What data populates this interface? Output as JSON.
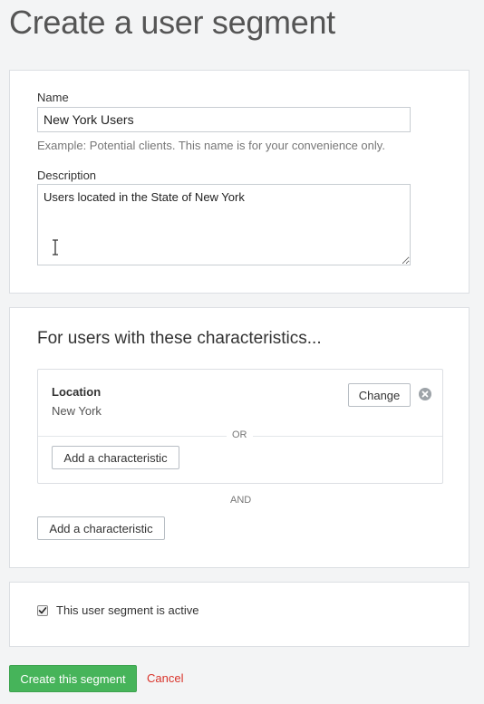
{
  "page": {
    "title": "Create a user segment"
  },
  "form": {
    "name_label": "Name",
    "name_value": "New York Users",
    "name_hint": "Example: Potential clients. This name is for your convenience only.",
    "description_label": "Description",
    "description_value": "Users located in the State of New York"
  },
  "characteristics": {
    "heading": "For users with these characteristics...",
    "items": [
      {
        "name": "Location",
        "value": "New York",
        "change_label": "Change",
        "remove_icon": "close-circle-icon"
      }
    ],
    "or_label": "OR",
    "add_inner_label": "Add a characteristic",
    "and_label": "AND",
    "add_outer_label": "Add a characteristic"
  },
  "status": {
    "active_label": "This user segment is active",
    "active_checked": true
  },
  "actions": {
    "submit_label": "Create this segment",
    "cancel_label": "Cancel"
  },
  "colors": {
    "primary": "#46b45a",
    "cancel": "#d9332a",
    "background": "#f3f4f5"
  }
}
